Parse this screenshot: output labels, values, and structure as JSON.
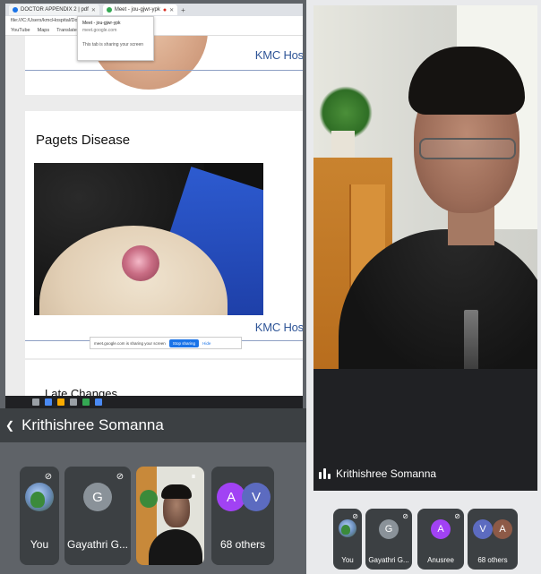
{
  "browser": {
    "tab1_title": "DOCTOR APPENDIX 2 | pdf",
    "tab2_title": "Meet - jou-gjwr-ypk",
    "address": "file:///C:/Users/kmcHospital/Downloads/DOC",
    "bookmarks": [
      "YouTube",
      "Maps",
      "Translate"
    ],
    "tooltip_title": "Meet - jou-gjwr-ypk",
    "tooltip_url": "meet.google.com",
    "tooltip_hint": "This tab is sharing your screen"
  },
  "slides": {
    "hospital_label_top": "KMC Hosp",
    "title": "Pagets Disease",
    "hospital_label_main": "KMC Hosp",
    "next_title": "Late Changes"
  },
  "share_notice": {
    "text": "meet.google.com is sharing your screen",
    "stop_label": "Stop sharing",
    "hide_label": "Hide"
  },
  "presenter": {
    "name": "Krithishree Somanna"
  },
  "participants_left": {
    "you_label": "You",
    "gayathri_initial": "G",
    "gayathri_label": "Gayathri G...",
    "others_initial_a": "A",
    "others_initial_v": "V",
    "others_label": "68 others"
  },
  "speaker": {
    "name": "Krithishree Somanna"
  },
  "participants_right": {
    "you_label": "You",
    "gayathri_initial": "G",
    "gayathri_label": "Gayathri G...",
    "anusree_initial": "A",
    "anusree_label": "Anusree",
    "others_initial_v": "V",
    "others_initial_a": "A",
    "others_label": "68 others"
  },
  "colors": {
    "meet_tile": "#3c4043",
    "avatar_gray": "#8a9299",
    "avatar_purple": "#a142f4",
    "avatar_indigo": "#5c6bc0",
    "avatar_brown": "#8d5a47",
    "kmc_blue": "#2f5597"
  }
}
